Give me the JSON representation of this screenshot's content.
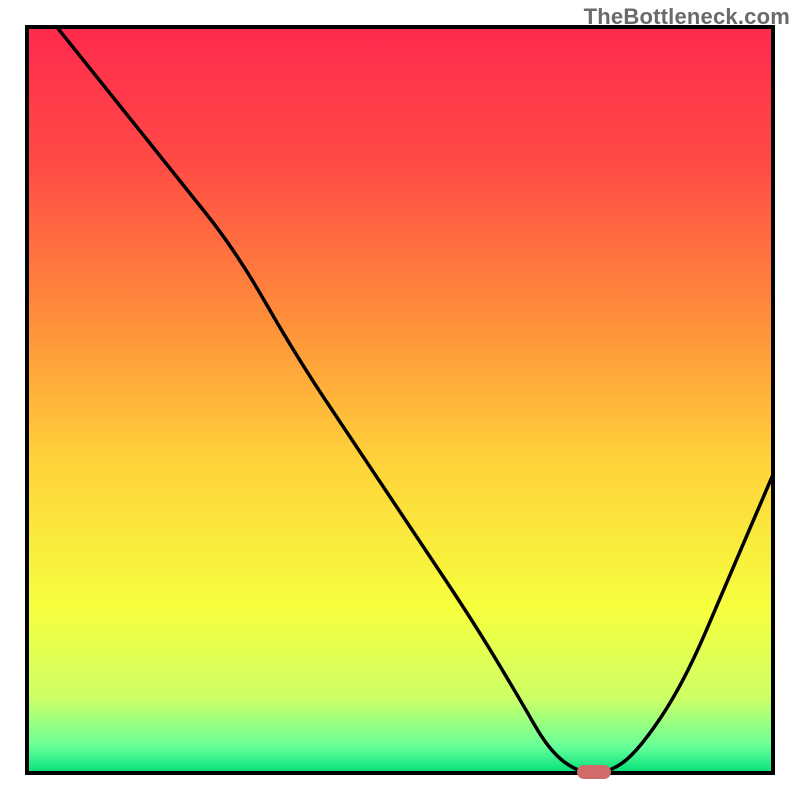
{
  "watermark": "TheBottleneck.com",
  "chart_data": {
    "type": "line",
    "title": "",
    "xlabel": "",
    "ylabel": "",
    "xlim": [
      0,
      100
    ],
    "ylim": [
      0,
      100
    ],
    "grid": false,
    "legend": false,
    "series": [
      {
        "name": "bottleneck-curve",
        "x": [
          4,
          12,
          20,
          28,
          36,
          44,
          52,
          60,
          66,
          70,
          74,
          78,
          82,
          88,
          94,
          100
        ],
        "y": [
          100,
          90,
          80,
          70,
          56,
          44,
          32,
          20,
          10,
          3,
          0,
          0,
          3,
          12,
          26,
          40
        ],
        "stroke": "#000000"
      }
    ],
    "marker": {
      "name": "optimal-point",
      "x": 76,
      "y": 0,
      "color": "#d36a6a",
      "shape": "rounded-rect"
    },
    "background_gradient": {
      "type": "vertical",
      "stops": [
        {
          "pos": 0.0,
          "color": "#ff2a4d"
        },
        {
          "pos": 0.18,
          "color": "#ff4a46"
        },
        {
          "pos": 0.38,
          "color": "#ff8a3a"
        },
        {
          "pos": 0.58,
          "color": "#ffd23a"
        },
        {
          "pos": 0.78,
          "color": "#f6ff3e"
        },
        {
          "pos": 0.9,
          "color": "#ccff66"
        },
        {
          "pos": 0.965,
          "color": "#66ff99"
        },
        {
          "pos": 1.0,
          "color": "#00e07a"
        }
      ]
    },
    "axes_color": "#000000"
  }
}
